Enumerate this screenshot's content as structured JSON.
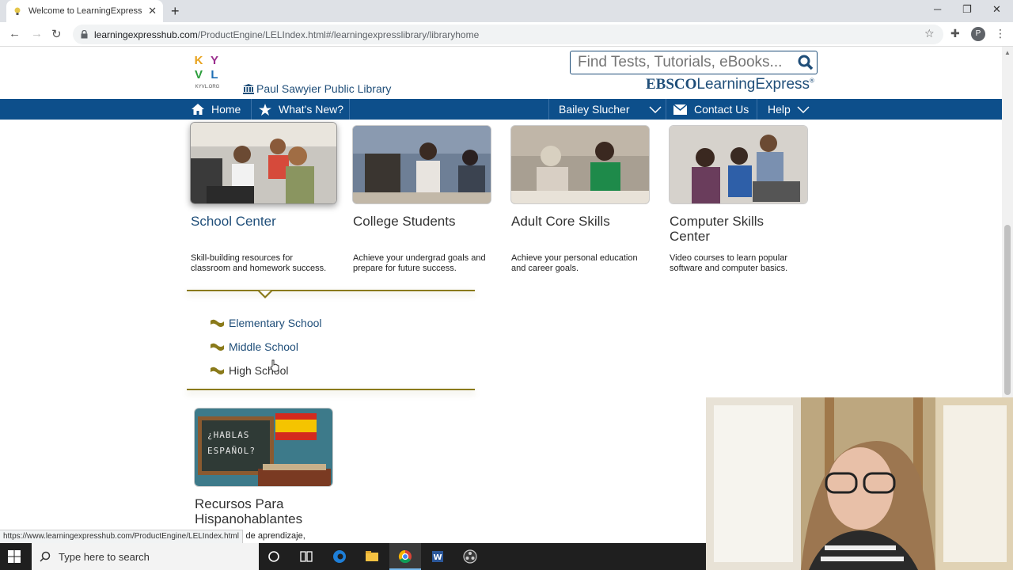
{
  "browser": {
    "tab_title": "Welcome to LearningExpress Libr",
    "url_host": "learningexpresshub.com",
    "url_path": "/ProductEngine/LELIndex.html#/learningexpresslibrary/libraryhome",
    "profile_initial": "P"
  },
  "header": {
    "logo_letters": [
      "K",
      "Y",
      "V",
      "L"
    ],
    "logo_caption": "KYVL.ORG",
    "library_name": "Paul Sawyier Public Library",
    "search_placeholder": "Find Tests, Tutorials, eBooks...",
    "brand_bold": "EBSCO",
    "brand_rest": "LearningExpress",
    "brand_mark": "®"
  },
  "nav": {
    "home": "Home",
    "whats_new": "What's New?",
    "user": "Bailey Slucher",
    "contact": "Contact Us",
    "help": "Help"
  },
  "cards": [
    {
      "title": "School Center",
      "desc": "Skill-building resources for classroom and homework success."
    },
    {
      "title": "College Students",
      "desc": "Achieve your undergrad goals and prepare for future success."
    },
    {
      "title": "Adult Core Skills",
      "desc": "Achieve your personal education and career goals."
    },
    {
      "title": "Computer Skills Center",
      "desc": "Video courses to learn popular software and computer basics."
    },
    {
      "title": "Recursos Para Hispanohablantes",
      "desc": "s de aprendizaje,"
    }
  ],
  "card_image_text": "¿HABLAS ESPAÑOL?",
  "sublinks": [
    "Elementary School",
    "Middle School",
    "High School"
  ],
  "status_url": "https://www.learningexpresshub.com/ProductEngine/LELIndex.html",
  "taskbar": {
    "search_placeholder": "Type here to search"
  },
  "colors": {
    "nav_blue": "#0d4f8b",
    "link_blue": "#1f4e79",
    "gold": "#8a7a1a"
  }
}
